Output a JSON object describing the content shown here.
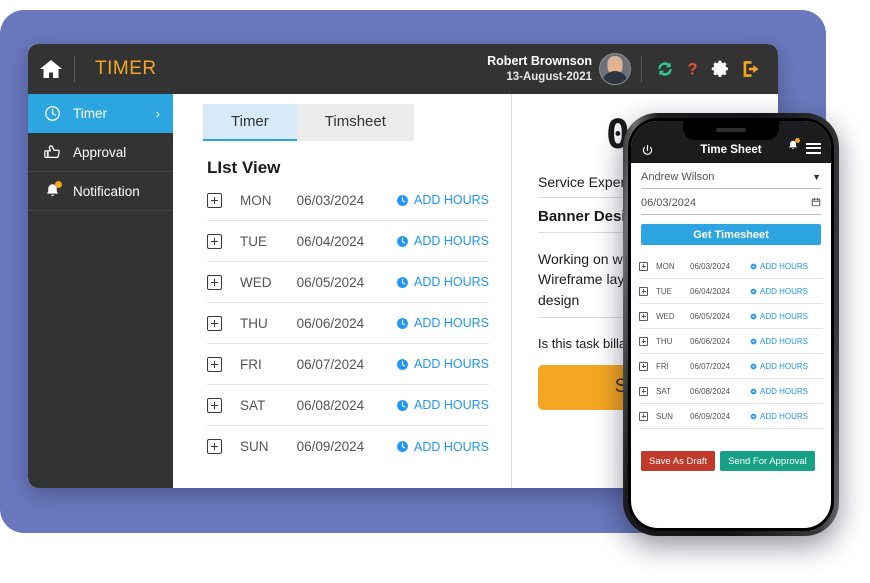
{
  "theme": {
    "backdrop": "#6a79bd",
    "header_bg": "#333333",
    "accent_blue": "#2ca5e0",
    "accent_orange": "#f5a623",
    "link_blue": "#2196f3",
    "draft_red": "#c0392b",
    "approve_teal": "#16a085",
    "refresh_green": "#2ecc8f",
    "help_red": "#e74c3c"
  },
  "desktop": {
    "header": {
      "home_icon": "home-icon",
      "title": "TIMER",
      "user_name": "Robert Brownson",
      "user_date": "13-August-2021",
      "avatar": "user-avatar",
      "icons": [
        {
          "name": "refresh-icon",
          "color": "#2ecc8f"
        },
        {
          "name": "help-icon",
          "color": "#e74c3c",
          "glyph": "?"
        },
        {
          "name": "settings-gear-icon",
          "color": "#ffffff"
        },
        {
          "name": "logout-icon",
          "color": "#f5a623"
        }
      ]
    },
    "sidebar": {
      "items": [
        {
          "label": "Timer",
          "icon": "clock-icon",
          "active": true,
          "chevron": "›"
        },
        {
          "label": "Approval",
          "icon": "thumbs-up-icon",
          "active": false
        },
        {
          "label": "Notification",
          "icon": "bell-icon",
          "active": false,
          "badge": true
        }
      ]
    },
    "tabs": [
      {
        "label": "Timer",
        "active": true
      },
      {
        "label": "Timsheet",
        "active": false
      }
    ],
    "list": {
      "title": "LIst View",
      "add_hours_label": "ADD HOURS",
      "rows": [
        {
          "day": "MON",
          "date": "06/03/2024"
        },
        {
          "day": "TUE",
          "date": "06/04/2024"
        },
        {
          "day": "WED",
          "date": "06/05/2024"
        },
        {
          "day": "THU",
          "date": "06/06/2024"
        },
        {
          "day": "FRI",
          "date": "06/07/2024"
        },
        {
          "day": "SAT",
          "date": "06/08/2024"
        },
        {
          "day": "SUN",
          "date": "06/09/2024"
        }
      ]
    },
    "timer": {
      "display": "00:",
      "client": "Service Expert",
      "task": "Banner Design",
      "description": "Working on web\nWireframe layou\ndesign",
      "billable_label": "Is this task billab",
      "start_label": "START"
    }
  },
  "phone": {
    "topbar": {
      "power_icon": "power-icon",
      "title": "Time Sheet",
      "bell_icon": "bell-icon",
      "menu_icon": "hamburger-menu-icon"
    },
    "employee": "Andrew Wilson",
    "date": "06/03/2024",
    "get_timesheet_label": "Get Timesheet",
    "add_hours_label": "ADD HOURS",
    "rows": [
      {
        "day": "MON",
        "date": "06/03/2024"
      },
      {
        "day": "TUE",
        "date": "06/04/2024"
      },
      {
        "day": "WED",
        "date": "06/05/2024"
      },
      {
        "day": "THU",
        "date": "06/06/2024"
      },
      {
        "day": "FRI",
        "date": "06/07/2024"
      },
      {
        "day": "SAT",
        "date": "06/08/2024"
      },
      {
        "day": "SUN",
        "date": "06/09/2024"
      }
    ],
    "actions": {
      "draft_label": "Save As Draft",
      "approval_label": "Send For Approval"
    }
  }
}
